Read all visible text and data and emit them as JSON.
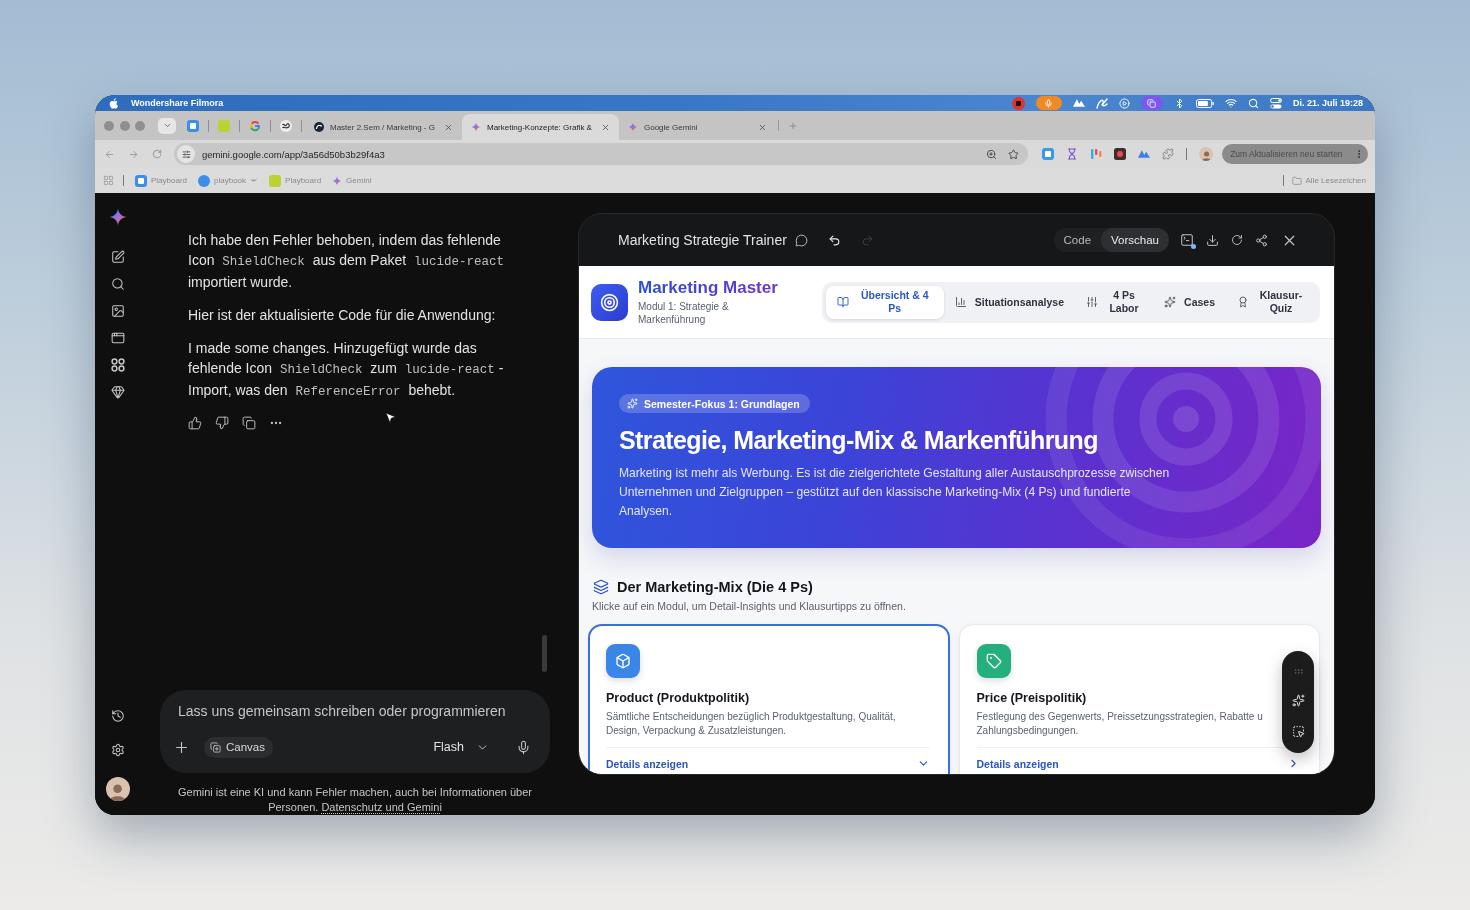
{
  "menu_bar": {
    "app_name": "Wondershare Filmora",
    "clock": "Di. 21. Juli 19:28"
  },
  "browser": {
    "tabs": [
      {
        "title": "Master 2.Sem / Marketing - G",
        "selected": false
      },
      {
        "title": "Marketing-Konzepte: Grafik &",
        "selected": true
      },
      {
        "title": "Google Gemini",
        "selected": false
      }
    ],
    "address": "gemini.google.com/app/3a56d50b3b29f4a3",
    "update_button": "Zum Aktualisieren neu starten",
    "bookmarks": [
      {
        "label": "Playboard"
      },
      {
        "label": "playbook"
      },
      {
        "label": "Playboard"
      },
      {
        "label": "Gemini"
      }
    ],
    "all_bookmarks": "Alle Lesezeichen"
  },
  "chat": {
    "messages": [
      {
        "segments": [
          {
            "kind": "text",
            "text": "Ich habe den Fehler behoben, indem das fehlende Icon "
          },
          {
            "kind": "code",
            "text": "ShieldCheck"
          },
          {
            "kind": "text",
            "text": " aus dem Paket "
          },
          {
            "kind": "code",
            "text": "lucide-react"
          },
          {
            "kind": "text",
            "text": " importiert wurde."
          }
        ]
      },
      {
        "segments": [
          {
            "kind": "text",
            "text": "Hier ist der aktualisierte Code für die Anwendung:"
          }
        ]
      },
      {
        "segments": [
          {
            "kind": "text",
            "text": "I made some changes. Hinzugefügt wurde das fehlende Icon "
          },
          {
            "kind": "code",
            "text": "ShieldCheck"
          },
          {
            "kind": "text",
            "text": " zum "
          },
          {
            "kind": "code",
            "text": "lucide-react"
          },
          {
            "kind": "text",
            "text": "-Import, was den "
          },
          {
            "kind": "code",
            "text": "ReferenceError"
          },
          {
            "kind": "text",
            "text": " behebt."
          }
        ]
      }
    ],
    "composer": {
      "placeholder": "Lass uns gemeinsam schreiben oder programmieren",
      "canvas_chip": {
        "label": "Canvas",
        "selected": true
      },
      "model": "Flash"
    },
    "disclaimer": {
      "text": "Gemini ist eine KI und kann Fehler machen, auch bei Informationen über Personen.",
      "link": "Datenschutz und Gemini"
    }
  },
  "canvas": {
    "title": "Marketing Strategie Trainer",
    "history": [
      {
        "kind": "undo",
        "disabled": false
      },
      {
        "kind": "redo",
        "disabled": true
      }
    ],
    "view_toggle": [
      {
        "label": "Code",
        "selected": false
      },
      {
        "label": "Vorschau",
        "selected": true
      }
    ],
    "app": {
      "brand": "Marketing Master",
      "subtitle": "Modul 1: Strategie & Markenführung",
      "nav": [
        {
          "label": "Übersicht & 4 Ps",
          "selected": true
        },
        {
          "label": "Situationsanalyse",
          "selected": false
        },
        {
          "label": "4 Ps Labor",
          "selected": false
        },
        {
          "label": "Cases",
          "selected": false
        },
        {
          "label": "Klausur-Quiz",
          "selected": false
        }
      ],
      "hero": {
        "badge": "Semester-Fokus 1: Grundlagen",
        "title": "Strategie, Marketing-Mix & Markenführung",
        "text": "Marketing ist mehr als Werbung. Es ist die zielgerichtete Gestaltung aller Austauschprozesse zwischen Unternehmen und Zielgruppen – gestützt auf den klassische Marketing-Mix (4 Ps) und fundierte Analysen."
      },
      "section": {
        "title": "Der Marketing-Mix (Die 4 Ps)",
        "subtitle": "Klicke auf ein Modul, um Detail-Insights und Klausurtipps zu öffnen."
      },
      "cards": [
        {
          "title": "Product (Produktpolitik)",
          "description": "Sämtliche Entscheidungen bezüglich Produktgestaltung, Qualität, Design, Verpackung & Zusatzleistungen.",
          "link": "Details anzeigen",
          "selected": true,
          "color": "#3a86e8"
        },
        {
          "title": "Price (Preispolitik)",
          "description": "Festlegung des Gegenwerts, Preissetzungsstrategien, Rabatte u Zahlungsbedingungen.",
          "link": "Details anzeigen",
          "selected": false,
          "color": "#24b07e"
        }
      ]
    }
  }
}
